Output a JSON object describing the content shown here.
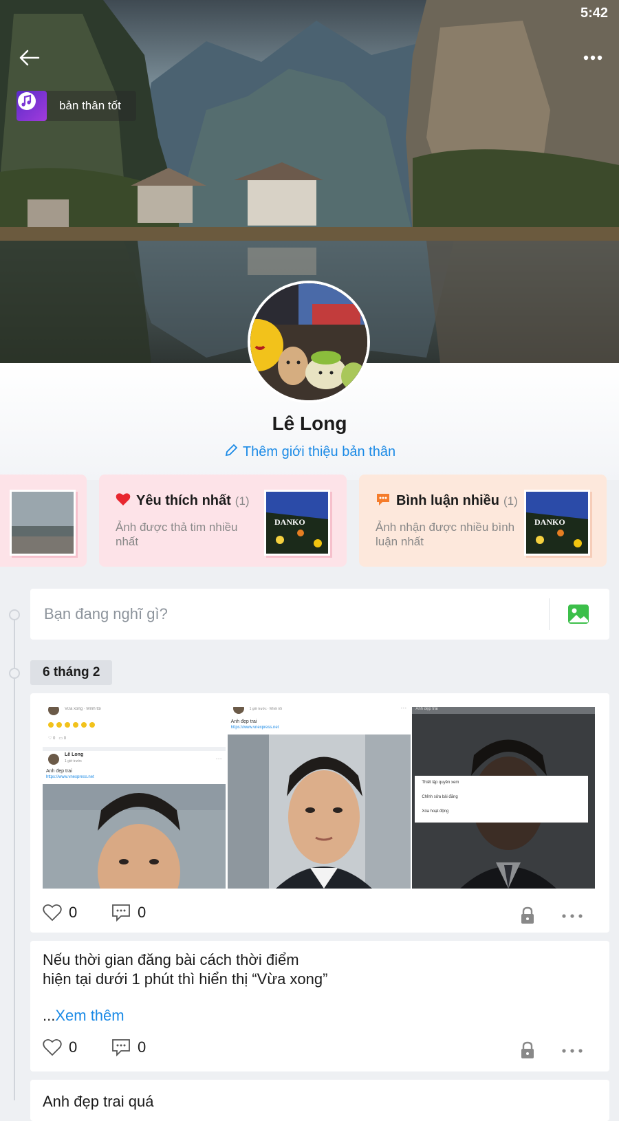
{
  "status_bar": {
    "time": "5:42"
  },
  "cover": {
    "music_title": "bản thân tốt"
  },
  "profile": {
    "name": "Lê Long",
    "bio_link": "Thêm giới thiệu bản thân"
  },
  "highlights": [
    {
      "title": "Yêu thích nhất",
      "count": "(1)",
      "desc": "Ảnh được thả tim nhiều nhất",
      "icon": "heart-icon"
    },
    {
      "title": "Bình luận nhiều",
      "count": "(1)",
      "desc": "Ảnh nhận được nhiều bình luận nhất",
      "icon": "comment-icon"
    }
  ],
  "compose": {
    "placeholder": "Bạn đang nghĩ gì?"
  },
  "timeline": {
    "date": "6 tháng 2"
  },
  "posts": [
    {
      "likes": "0",
      "comments": "0",
      "images": [
        {
          "status": "Vừa xong",
          "reply": "Mình tôi",
          "author": "Lê Long",
          "time": "1 giờ trước",
          "text": "Anh đẹp trai",
          "link": "https://www.vnexpress.net"
        },
        {
          "time": "1 giờ trước",
          "reply": "Mình tôi",
          "text": "Anh đẹp trai",
          "link": "https://www.vnexpress.net"
        },
        {
          "title": "Anh đẹp trai",
          "menu": [
            "Thiết lập quyền xem",
            "Chỉnh sửa bài đăng",
            "Xóa hoạt động"
          ]
        }
      ]
    },
    {
      "text": "Nếu thời gian đăng bài cách thời điểm hiện tại dưới 1 phút thì hiển thị “Vừa xong”",
      "ellipsis": "...",
      "see_more": "Xem thêm",
      "likes": "0",
      "comments": "0"
    },
    {
      "text": "Anh đẹp trai quá"
    }
  ],
  "colors": {
    "accent": "#1a8ae6",
    "heart": "#e8262f",
    "comment": "#f57c2b",
    "photo": "#3cbf4a"
  }
}
